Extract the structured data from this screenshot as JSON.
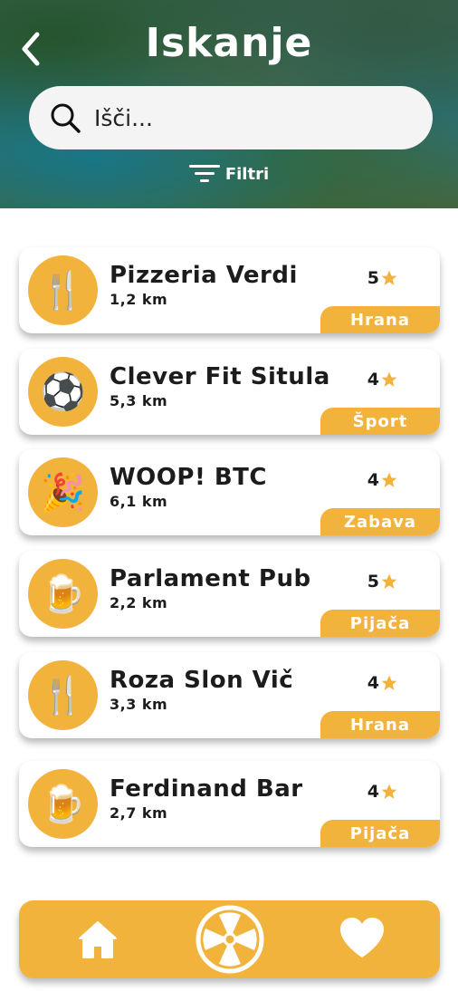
{
  "header": {
    "title": "Iskanje"
  },
  "search": {
    "placeholder": "Išči..."
  },
  "filters": {
    "label": "Filtri"
  },
  "places": [
    {
      "name": "Pizzeria Verdi",
      "distance": "1,2 km",
      "rating": "5",
      "category": "Hrana",
      "icon": "fork-knife-icon",
      "emoji": "🍴"
    },
    {
      "name": "Clever Fit Situla",
      "distance": "5,3 km",
      "rating": "4",
      "category": "Šport",
      "icon": "soccer-ball-icon",
      "emoji": "⚽"
    },
    {
      "name": "WOOP! BTC",
      "distance": "6,1 km",
      "rating": "4",
      "category": "Zabava",
      "icon": "party-popper-icon",
      "emoji": "🎉"
    },
    {
      "name": "Parlament Pub",
      "distance": "2,2 km",
      "rating": "5",
      "category": "Pijača",
      "icon": "beer-mug-icon",
      "emoji": "🍺"
    },
    {
      "name": "Roza Slon Vič",
      "distance": "3,3 km",
      "rating": "4",
      "category": "Hrana",
      "icon": "fork-knife-icon",
      "emoji": "🍴"
    },
    {
      "name": "Ferdinand Bar",
      "distance": "2,7 km",
      "rating": "4",
      "category": "Pijača",
      "icon": "beer-mug-icon",
      "emoji": "🍺"
    }
  ],
  "colors": {
    "accent": "#f2b33d",
    "text": "#1c1c1c",
    "search_bg": "#f4f4f4"
  },
  "nav": {
    "items": [
      "home-icon",
      "wheel-icon",
      "heart-icon"
    ]
  }
}
